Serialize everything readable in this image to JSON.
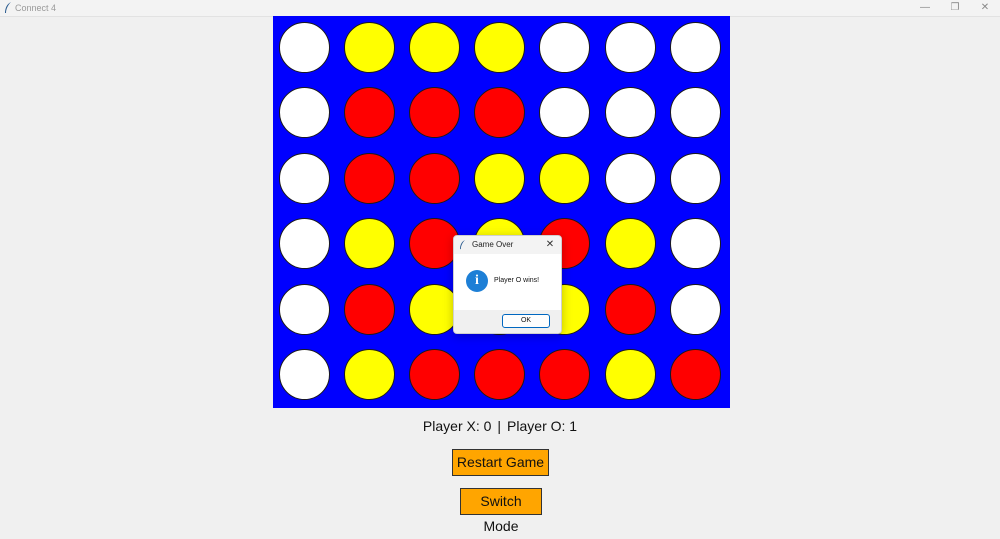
{
  "window": {
    "title": "Connect 4",
    "controls": {
      "minimize": "—",
      "restore": "❐",
      "close": "✕"
    }
  },
  "board": {
    "rows": 6,
    "columns": 7,
    "colors": {
      "background": "#0000ff",
      "empty": "#ffffff",
      "red": "#ff0000",
      "yellow": "#ffff00"
    },
    "cells": [
      [
        "empty",
        "yellow",
        "yellow",
        "yellow",
        "empty",
        "empty",
        "empty"
      ],
      [
        "empty",
        "red",
        "red",
        "red",
        "empty",
        "empty",
        "empty"
      ],
      [
        "empty",
        "red",
        "red",
        "yellow",
        "yellow",
        "empty",
        "empty"
      ],
      [
        "empty",
        "yellow",
        "red",
        "yellow",
        "red",
        "yellow",
        "empty"
      ],
      [
        "empty",
        "red",
        "yellow",
        "yellow",
        "yellow",
        "red",
        "empty"
      ],
      [
        "empty",
        "yellow",
        "red",
        "red",
        "red",
        "yellow",
        "red"
      ]
    ]
  },
  "scoreboard": {
    "player_x": "Player X: 0",
    "separator": "|",
    "player_o": "Player O: 1"
  },
  "buttons": {
    "restart": "Restart Game",
    "switch_mode": "Switch Mode",
    "color": "#ffa500"
  },
  "dialog": {
    "title": "Game Over",
    "close": "✕",
    "icon": "info-icon",
    "icon_glyph": "i",
    "message": "Player O wins!",
    "ok": "OK"
  }
}
